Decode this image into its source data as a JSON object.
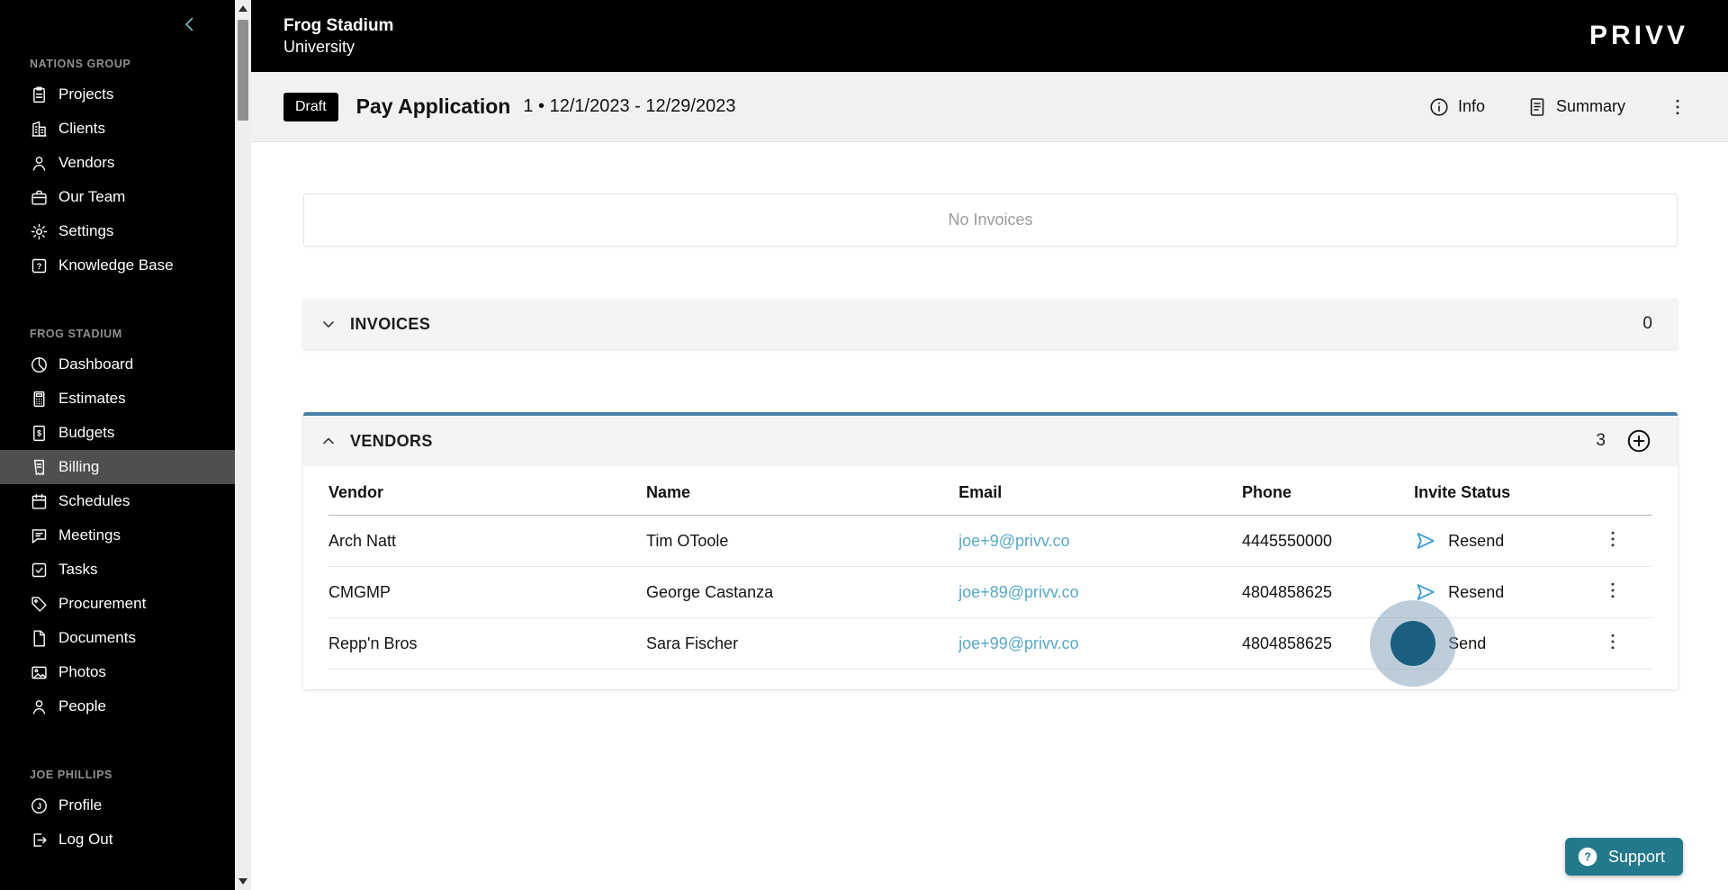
{
  "sidebar": {
    "sections": [
      {
        "label": "NATIONS GROUP",
        "items": [
          {
            "label": "Projects",
            "icon": "projects-icon"
          },
          {
            "label": "Clients",
            "icon": "clients-icon"
          },
          {
            "label": "Vendors",
            "icon": "vendors-icon"
          },
          {
            "label": "Our Team",
            "icon": "our-team-icon"
          },
          {
            "label": "Settings",
            "icon": "settings-icon"
          },
          {
            "label": "Knowledge Base",
            "icon": "knowledge-base-icon"
          }
        ]
      },
      {
        "label": "FROG STADIUM",
        "items": [
          {
            "label": "Dashboard",
            "icon": "dashboard-icon"
          },
          {
            "label": "Estimates",
            "icon": "estimates-icon"
          },
          {
            "label": "Budgets",
            "icon": "budgets-icon"
          },
          {
            "label": "Billing",
            "icon": "billing-icon",
            "active": true
          },
          {
            "label": "Schedules",
            "icon": "schedules-icon"
          },
          {
            "label": "Meetings",
            "icon": "meetings-icon"
          },
          {
            "label": "Tasks",
            "icon": "tasks-icon"
          },
          {
            "label": "Procurement",
            "icon": "procurement-icon"
          },
          {
            "label": "Documents",
            "icon": "documents-icon"
          },
          {
            "label": "Photos",
            "icon": "photos-icon"
          },
          {
            "label": "People",
            "icon": "people-icon"
          }
        ]
      },
      {
        "label": "JOE PHILLIPS",
        "items": [
          {
            "label": "Profile",
            "icon": "profile-icon"
          },
          {
            "label": "Log Out",
            "icon": "logout-icon"
          }
        ]
      }
    ]
  },
  "header": {
    "project": "Frog Stadium",
    "subtitle": "University",
    "brand": "PRIVV"
  },
  "toolbar": {
    "badge": "Draft",
    "title": "Pay Application",
    "meta": "1 • 12/1/2023 - 12/29/2023",
    "info": "Info",
    "summary": "Summary"
  },
  "content": {
    "empty_state": "No Invoices",
    "invoices": {
      "label": "INVOICES",
      "count": "0"
    },
    "vendors": {
      "label": "VENDORS",
      "count": "3"
    },
    "table": {
      "columns": [
        "Vendor",
        "Name",
        "Email",
        "Phone",
        "Invite Status"
      ],
      "rows": [
        {
          "vendor": "Arch Natt",
          "name": "Tim OToole",
          "email": "joe+9@privv.co",
          "phone": "4445550000",
          "action": "Resend"
        },
        {
          "vendor": "CMGMP",
          "name": "George Castanza",
          "email": "joe+89@privv.co",
          "phone": "4804858625",
          "action": "Resend"
        },
        {
          "vendor": "Repp'n Bros",
          "name": "Sara Fischer",
          "email": "joe+99@privv.co",
          "phone": "4804858625",
          "action": "Send"
        }
      ]
    }
  },
  "support": {
    "label": "Support"
  },
  "colors": {
    "accent": "#4a80a8",
    "email_link": "#57a9c9",
    "send_icon": "#2e96d4",
    "support_bg": "#24788c",
    "badge_bg": "#000000",
    "active_item_bg": "#4f4f4f"
  }
}
